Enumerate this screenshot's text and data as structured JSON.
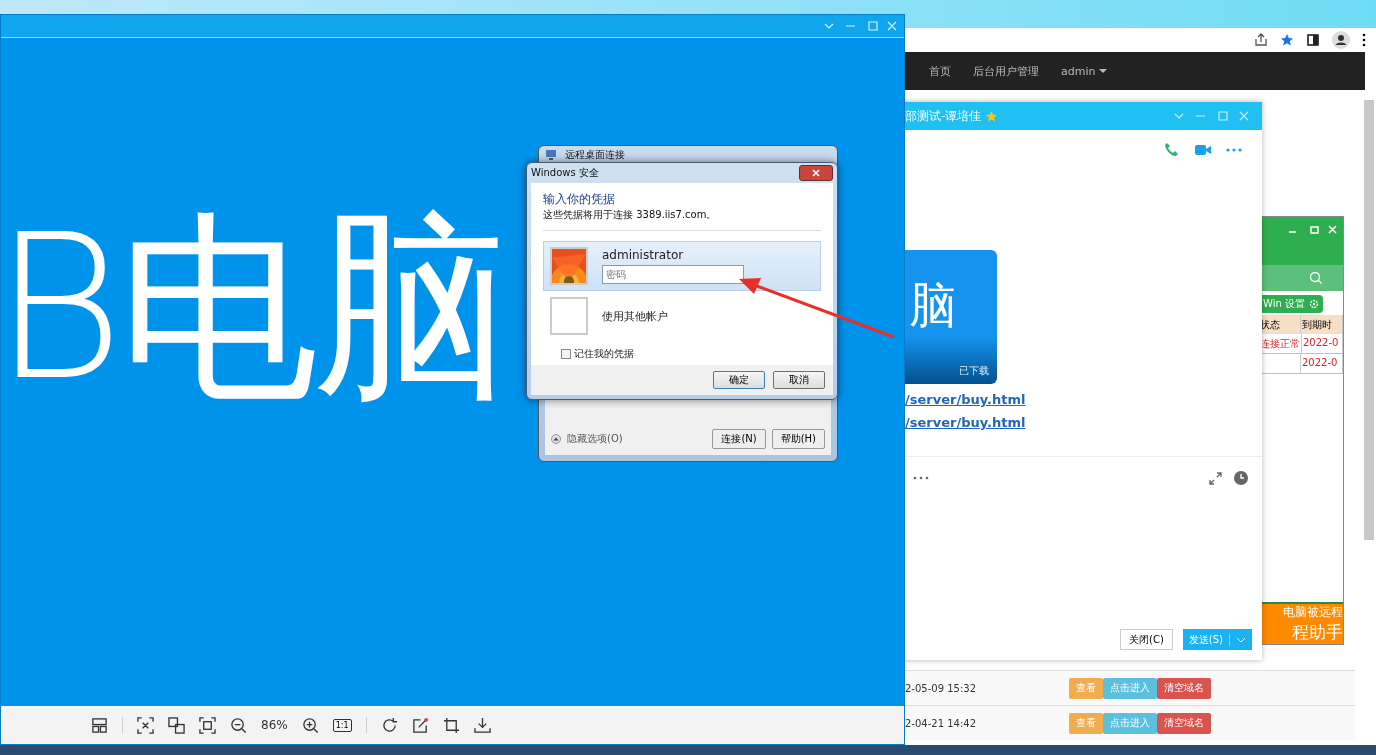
{
  "viewer": {
    "big_text": "B电脑",
    "zoom": "86%",
    "actual_size": "1:1"
  },
  "browser": {
    "nav": [
      {
        "label": "首页",
        "dropdown": false
      },
      {
        "label": "后台用户管理",
        "dropdown": false
      },
      {
        "label": "admin",
        "dropdown": true
      }
    ]
  },
  "chat": {
    "title": "部测试-谭培佳",
    "card_big": "脑",
    "card_caption": "已下载",
    "links": [
      "/server/buy.html",
      "/server/buy.html"
    ],
    "close_button": "关闭(C)",
    "send_button": "发送(S)"
  },
  "green_app": {
    "settings_button": "Win 设置",
    "columns": [
      "状态",
      "到期时"
    ],
    "rows": [
      {
        "status": "连接正常",
        "expiry": "2022-0"
      },
      {
        "status": "",
        "expiry": "2022-0"
      }
    ],
    "banner": [
      "电脑被远程",
      "程助手"
    ]
  },
  "table_rows": [
    {
      "time": "2-05-09 15:32",
      "actions": [
        {
          "label": "查看",
          "kind": "view"
        },
        {
          "label": "点击进入",
          "kind": "enter"
        },
        {
          "label": "清空域名",
          "kind": "clear"
        }
      ]
    },
    {
      "time": "2-04-21 14:42",
      "actions": [
        {
          "label": "查看",
          "kind": "view"
        },
        {
          "label": "点击进入",
          "kind": "enter"
        },
        {
          "label": "清空域名",
          "kind": "clear"
        }
      ]
    }
  ],
  "rdp": {
    "title": "远程桌面连接",
    "options": "隐藏选项(O)",
    "connect": "连接(N)",
    "help": "帮助(H)"
  },
  "security": {
    "title": "Windows 安全",
    "heading": "输入你的凭据",
    "subtitle": "这些凭据将用于连接 3389.iis7.com。",
    "user": "administrator",
    "password_placeholder": "密码",
    "other_account": "使用其他帐户",
    "remember": {
      "label": "记住我的凭据",
      "checked": false
    },
    "ok": "确定",
    "cancel": "取消"
  }
}
